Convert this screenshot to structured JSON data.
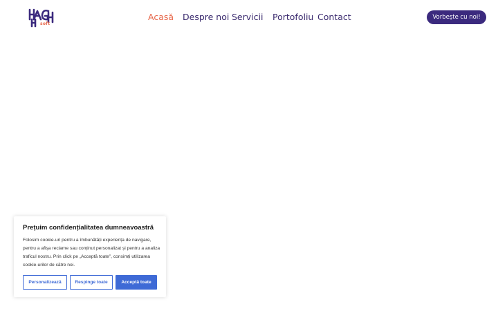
{
  "brand": {
    "logo_sub": "soft",
    "colors": {
      "primary": "#3b2a7e",
      "accent": "#e8674a",
      "cookie_blue": "#3e6ad6"
    }
  },
  "nav": {
    "items": [
      {
        "label": "Acasă",
        "active": true
      },
      {
        "label": "Despre noi",
        "active": false
      },
      {
        "label": "Servicii",
        "active": false
      },
      {
        "label": "Portofoliu",
        "active": false
      },
      {
        "label": "Contact",
        "active": false
      }
    ],
    "cta_label": "Vorbește cu noi!"
  },
  "cookie": {
    "title": "Prețuim confidențialitatea dumneavoastră",
    "text": "Folosim cookie-uri pentru a îmbunătăți experiența de navigare, pentru a afișa reclame sau conținut personalizat și pentru a analiza traficul nostru. Prin click pe „Acceptă toate”, consimți utilizarea cookie-urilor de către noi.",
    "buttons": {
      "personalize": "Personalizează",
      "reject": "Respinge toate",
      "accept": "Acceptă toate"
    }
  }
}
